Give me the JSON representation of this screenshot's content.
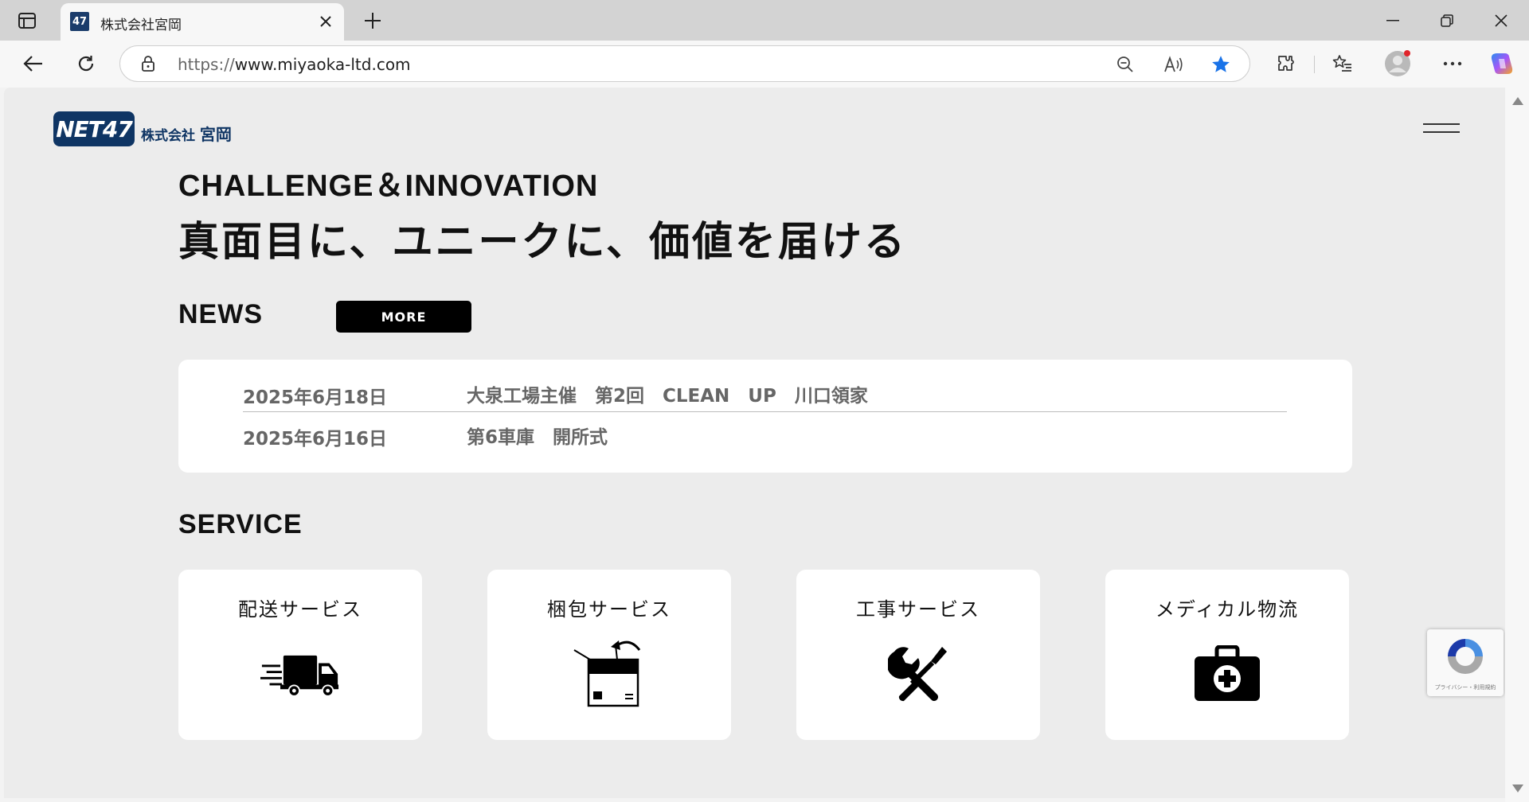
{
  "browser": {
    "tab_title": "株式会社宮岡",
    "tab_favicon_text": "47",
    "url_protocol": "https://",
    "url_host": "www.miyaoka-ltd.com",
    "favorite_active_color": "#1a73e8"
  },
  "header": {
    "logo_mark": "NET47",
    "logo_company_small": "株式会社",
    "logo_company_name": "宮岡"
  },
  "hero": {
    "tagline_en": "CHALLENGE＆INNOVATION",
    "tagline_jp": "真面目に、ユニークに、価値を届ける"
  },
  "news": {
    "heading": "NEWS",
    "more_label": "MORE",
    "items": [
      {
        "date": "2025年6月18日",
        "title": "大泉工場主催　第2回　CLEAN　UP　川口領家"
      },
      {
        "date": "2025年6月16日",
        "title": "第6車庫　開所式"
      }
    ]
  },
  "service": {
    "heading": "SERVICE",
    "cards": [
      {
        "label": "配送サービス",
        "icon": "delivery-truck-icon"
      },
      {
        "label": "梱包サービス",
        "icon": "packing-box-icon"
      },
      {
        "label": "工事サービス",
        "icon": "tools-icon"
      },
      {
        "label": "メディカル物流",
        "icon": "medical-kit-icon"
      }
    ]
  },
  "recaptcha": {
    "text": "プライバシー・利用規約"
  }
}
